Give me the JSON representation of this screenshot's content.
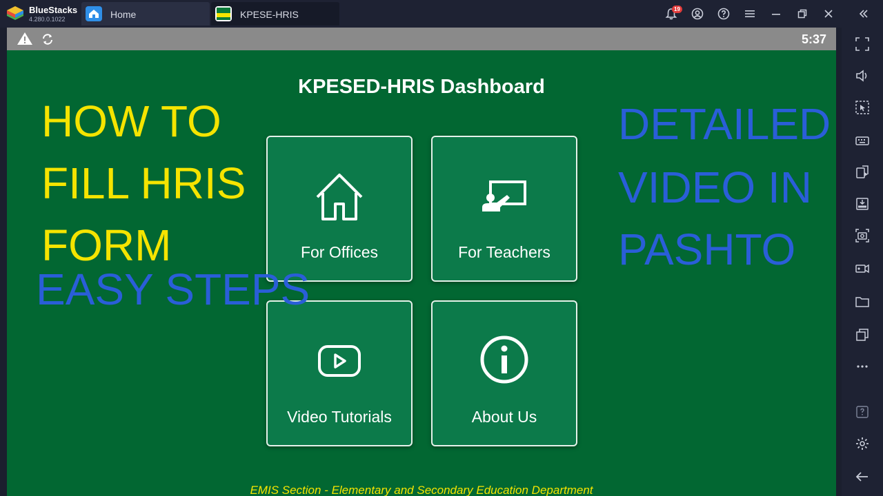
{
  "app": {
    "name": "BlueStacks",
    "version": "4.280.0.1022",
    "notification_count": "19"
  },
  "tabs": [
    {
      "label": "Home"
    },
    {
      "label": "KPESE-HRIS"
    }
  ],
  "statusbar": {
    "time": "5:37"
  },
  "dashboard": {
    "title": "KPESED-HRIS Dashboard",
    "cards": [
      {
        "label": "For Offices",
        "icon": "home-icon"
      },
      {
        "label": "For Teachers",
        "icon": "teacher-board-icon"
      },
      {
        "label": "Video Tutorials",
        "icon": "play-video-icon"
      },
      {
        "label": "About Us",
        "icon": "info-icon"
      }
    ],
    "footer": "EMIS Section - Elementary and Secondary Education Department"
  },
  "overlay_text": {
    "left_yellow": [
      "HOW TO",
      "FILL HRIS",
      "FORM"
    ],
    "left_blue": "EASY STEPS",
    "right_blue": [
      "DETAILED",
      "VIDEO IN",
      "PASHTO"
    ]
  },
  "colors": {
    "screen_bg": "#026732",
    "card_bg": "#0c7a4a",
    "overlay_yellow": "#f5e400",
    "overlay_blue": "#2a5ed8",
    "chrome_bg": "#1e2233"
  }
}
